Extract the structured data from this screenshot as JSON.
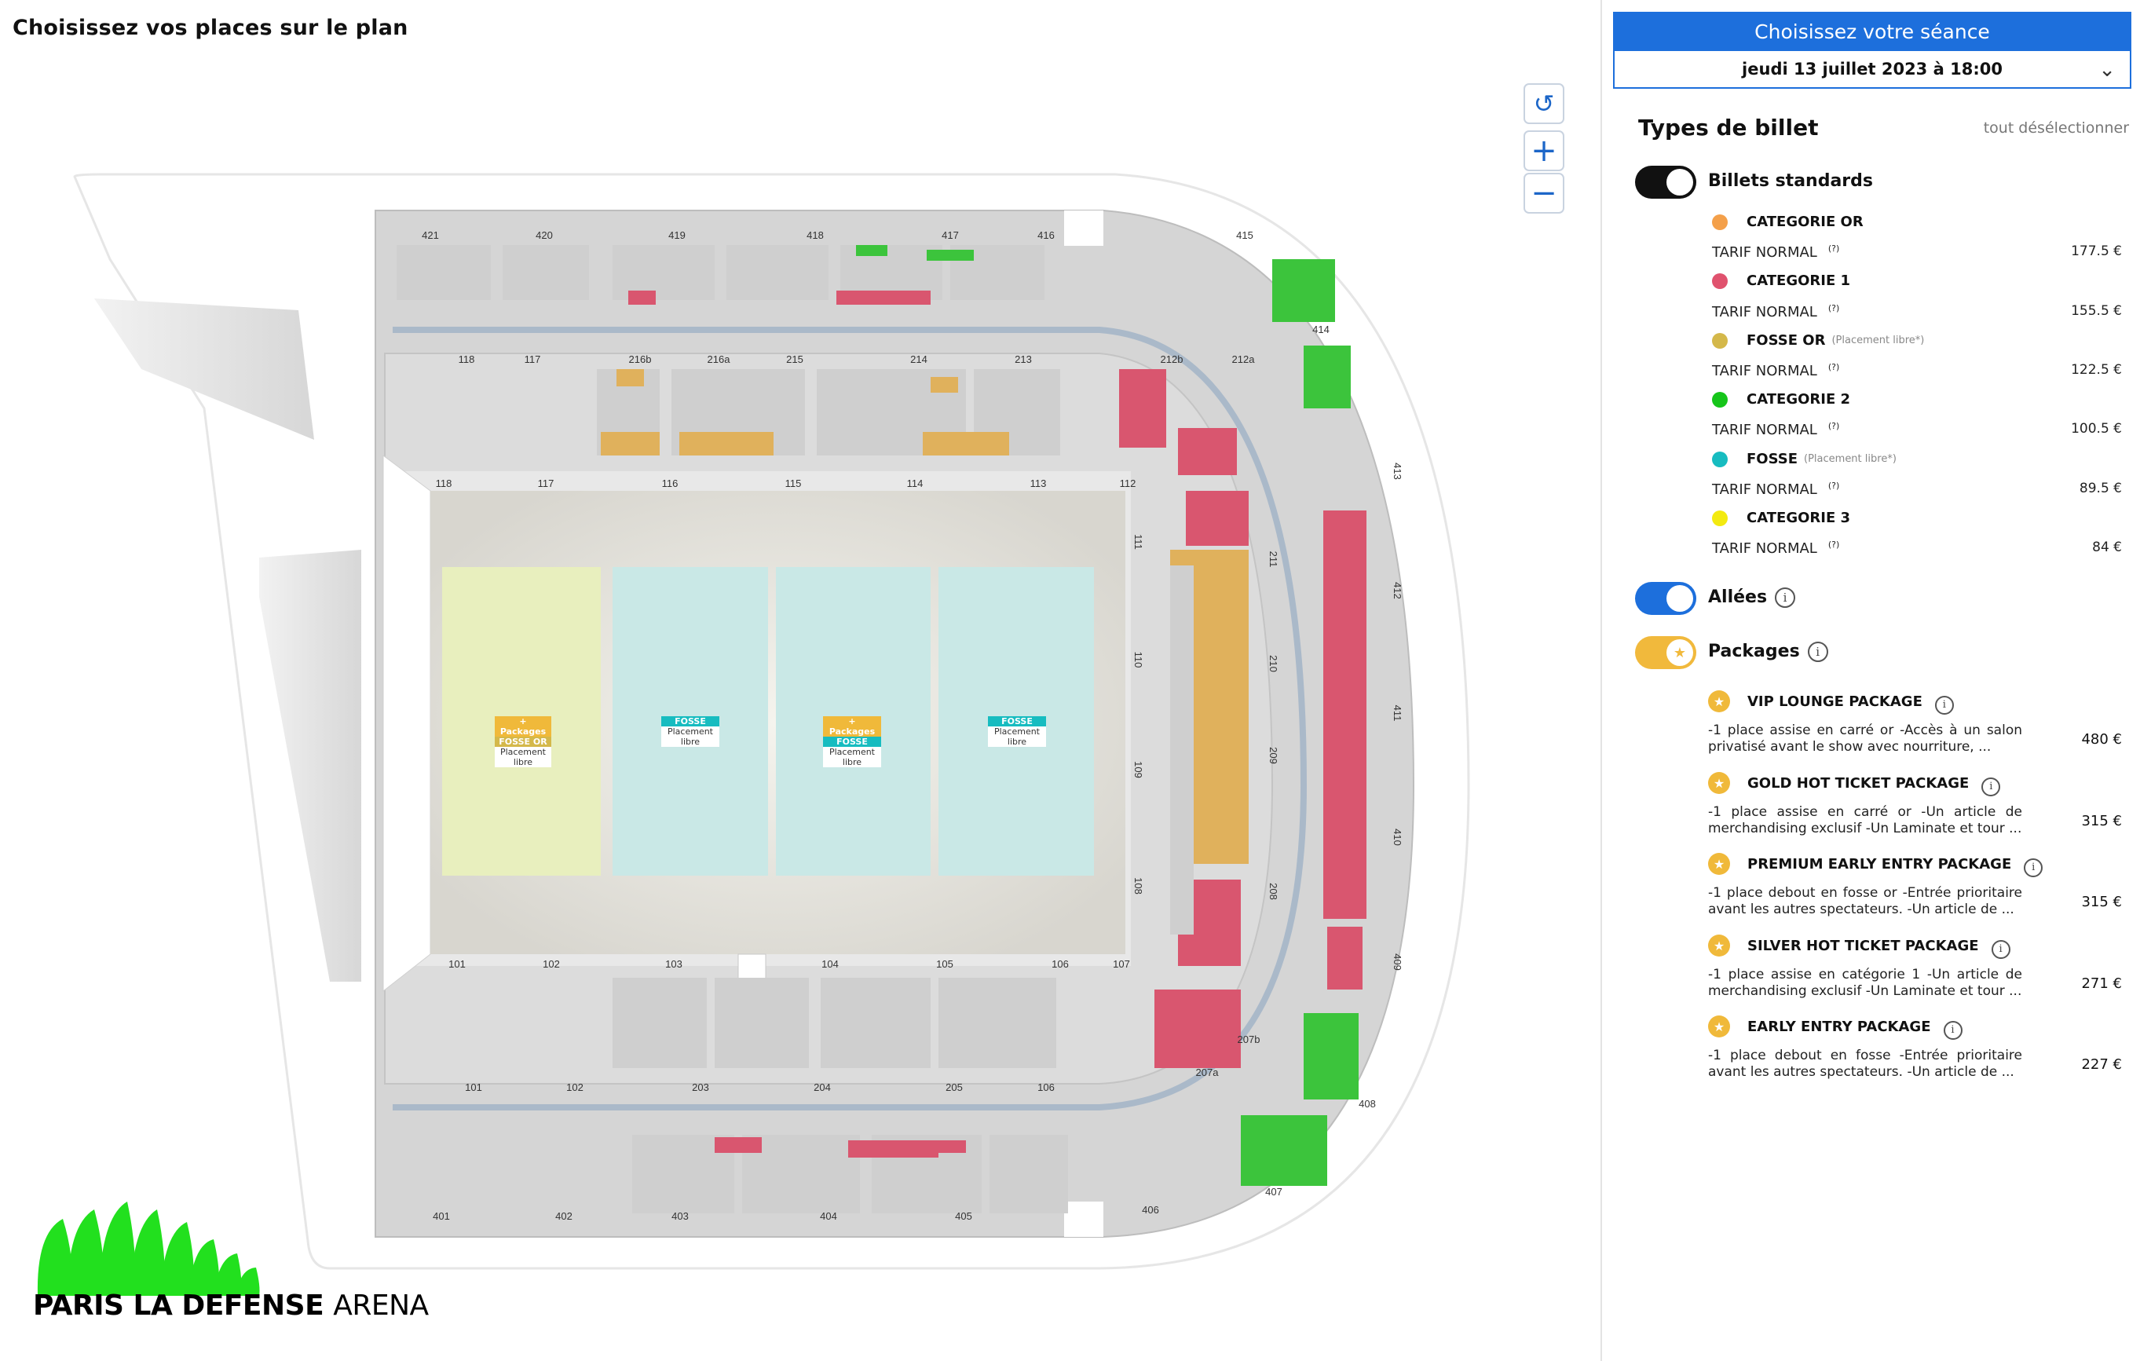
{
  "page": {
    "title": "Choisissez vos places sur le plan"
  },
  "map_controls": {
    "reset_icon": "rotate-ccw-icon",
    "zoom_in_icon": "plus-icon",
    "zoom_out_icon": "minus-icon"
  },
  "venue": {
    "logo_text_bold": "PARIS LA DEFENSE",
    "logo_text_thin": "ARENA",
    "section_labels": {
      "upper_top": [
        "421",
        "420",
        "419",
        "418",
        "417",
        "416",
        "415"
      ],
      "mid_top_outer": [
        "118",
        "117",
        "216b",
        "216a",
        "215",
        "214",
        "213",
        "212b",
        "212a"
      ],
      "mid_top_inner": [
        "118",
        "117",
        "116",
        "115",
        "114",
        "113",
        "112"
      ],
      "right_inner": [
        "111",
        "110",
        "109",
        "108"
      ],
      "right_mid": [
        "211",
        "210",
        "209",
        "208",
        "207b",
        "207a"
      ],
      "right_outer": [
        "414",
        "413",
        "412",
        "411",
        "410",
        "409",
        "408",
        "407",
        "406"
      ],
      "mid_bottom_inner": [
        "101",
        "102",
        "103",
        "104",
        "105",
        "106",
        "107"
      ],
      "mid_bottom_outer": [
        "101",
        "102",
        "203",
        "204",
        "205",
        "106"
      ],
      "upper_bottom": [
        "401",
        "402",
        "403",
        "404",
        "405"
      ]
    },
    "pit_zones": [
      {
        "tags": [
          "+ Packages",
          "FOSSE OR"
        ],
        "sub": "Placement libre",
        "color": "#e7efbd"
      },
      {
        "tags": [
          "FOSSE"
        ],
        "sub": "Placement libre",
        "color": "#c8e8e6"
      },
      {
        "tags": [
          "+ Packages",
          "FOSSE"
        ],
        "sub": "Placement libre",
        "color": "#c8e8e6"
      },
      {
        "tags": [
          "FOSSE"
        ],
        "sub": "Placement libre",
        "color": "#c8e8e6"
      }
    ]
  },
  "session": {
    "header": "Choisissez votre séance",
    "selected": "jeudi 13 juillet 2023 à 18:00",
    "chevron_icon": "chevron-down-icon"
  },
  "ticket_types": {
    "title": "Types de billet",
    "deselect_all": "tout désélectionner",
    "standard_toggle": {
      "label": "Billets standards",
      "on": true
    },
    "categories": [
      {
        "name": "CATEGORIE OR",
        "note": "",
        "color": "#f4a04a",
        "tarif": "TARIF NORMAL",
        "help": "(?)",
        "price": "177.5 €"
      },
      {
        "name": "CATEGORIE 1",
        "note": "",
        "color": "#e0526e",
        "tarif": "TARIF NORMAL",
        "help": "(?)",
        "price": "155.5 €"
      },
      {
        "name": "FOSSE OR",
        "note": "(Placement libre*)",
        "color": "#d4b84a",
        "tarif": "TARIF NORMAL",
        "help": "(?)",
        "price": "122.5 €"
      },
      {
        "name": "CATEGORIE 2",
        "note": "",
        "color": "#16c51a",
        "tarif": "TARIF NORMAL",
        "help": "(?)",
        "price": "100.5 €"
      },
      {
        "name": "FOSSE",
        "note": "(Placement libre*)",
        "color": "#17bcc0",
        "tarif": "TARIF NORMAL",
        "help": "(?)",
        "price": "89.5 €"
      },
      {
        "name": "CATEGORIE 3",
        "note": "",
        "color": "#f3ea10",
        "tarif": "TARIF NORMAL",
        "help": "(?)",
        "price": "84 €"
      }
    ],
    "allees_toggle": {
      "label": "Allées",
      "on": true
    },
    "packages_toggle": {
      "label": "Packages",
      "on": true
    },
    "packages": [
      {
        "name": "VIP LOUNGE PACKAGE",
        "desc": "-1 place assise en carré or -Accès à un salon privatisé avant le show avec nourriture, ...",
        "price": "480 €"
      },
      {
        "name": "GOLD HOT TICKET PACKAGE",
        "desc": "-1 place assise en carré or -Un article de merchandising exclusif -Un Laminate et tour ...",
        "price": "315 €"
      },
      {
        "name": "PREMIUM EARLY ENTRY PACKAGE",
        "desc": "-1 place debout en fosse or -Entrée prioritaire avant les autres spectateurs. -Un article de ...",
        "price": "315 €"
      },
      {
        "name": "SILVER HOT TICKET PACKAGE",
        "desc": "-1 place assise en catégorie 1 -Un article de merchandising exclusif -Un Laminate et tour ...",
        "price": "271 €"
      },
      {
        "name": "EARLY ENTRY PACKAGE",
        "desc": "-1 place debout en fosse -Entrée prioritaire avant les autres spectateurs. -Un article de ...",
        "price": "227 €"
      }
    ]
  },
  "colors": {
    "accent_blue": "#1d6fdc",
    "toggle_black": "#111111",
    "toggle_yellow": "#f1b93c",
    "seat_grey": "#cfcfcf",
    "seat_red": "#d9566f",
    "seat_gold": "#e0b15c",
    "seat_green": "#3cc43c"
  }
}
